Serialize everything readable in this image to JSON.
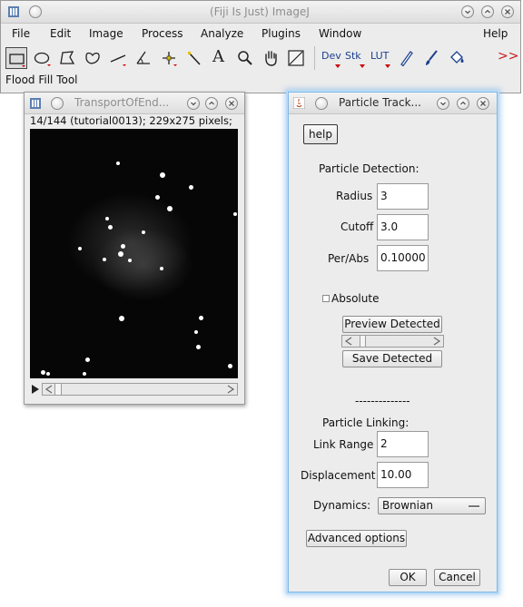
{
  "imagej": {
    "title": "(Fiji Is Just) ImageJ",
    "menus": [
      "File",
      "Edit",
      "Image",
      "Process",
      "Analyze",
      "Plugins",
      "Window",
      "Help"
    ],
    "tool_labels": {
      "dev": "Dev",
      "stk": "Stk",
      "lut": "LUT",
      "text": "A",
      "more": ">>"
    },
    "status": "Flood Fill Tool"
  },
  "image_window": {
    "title": "TransportOfEnd...",
    "info": "14/144 (tutorial0013); 229x275 pixels;"
  },
  "tracker": {
    "title": "Particle Track...",
    "help_label": "help",
    "detection_header": "Particle Detection:",
    "radius_label": "Radius",
    "radius_value": "3",
    "cutoff_label": "Cutoff",
    "cutoff_value": "3.0",
    "perabs_label": "Per/Abs",
    "perabs_value": "0.10000",
    "absolute_label": "Absolute",
    "absolute_checked": false,
    "preview_label": "Preview Detected",
    "save_label": "Save Detected",
    "separator_text": "--------------",
    "linking_header": "Particle Linking:",
    "linkrange_label": "Link Range",
    "linkrange_value": "2",
    "displacement_label": "Displacement",
    "displacement_value": "10.00",
    "dynamics_label": "Dynamics:",
    "dynamics_value": "Brownian",
    "advanced_label": "Advanced options",
    "ok_label": "OK",
    "cancel_label": "Cancel"
  }
}
